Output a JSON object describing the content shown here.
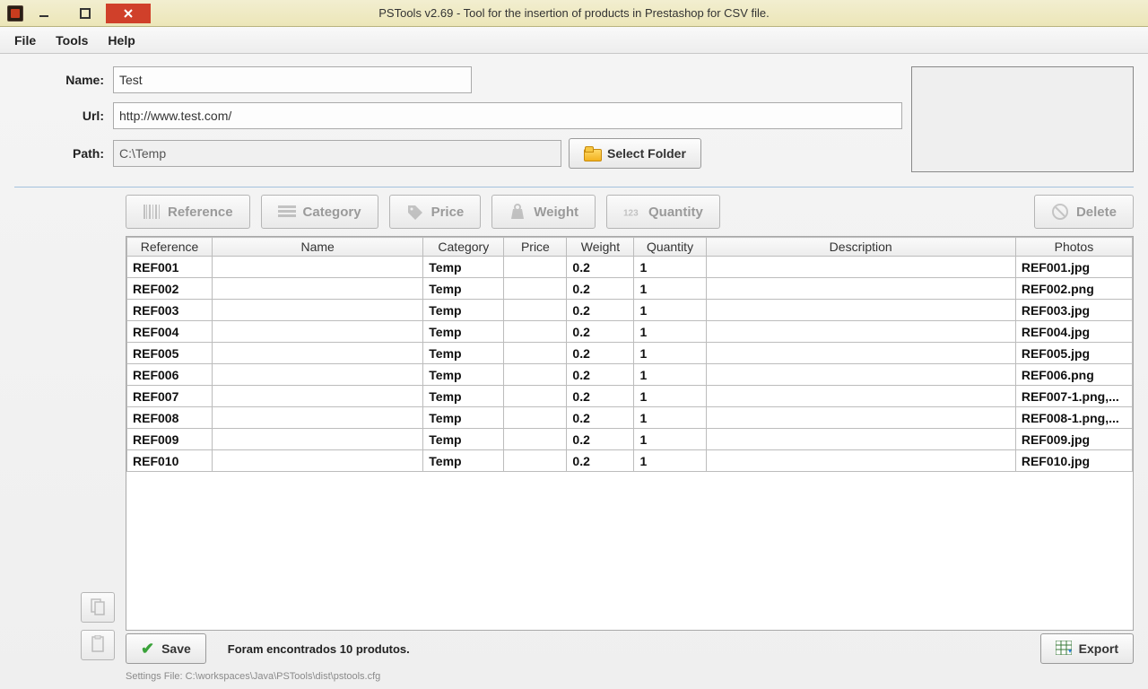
{
  "window": {
    "title": "PSTools v2.69 - Tool for the insertion of products in Prestashop for CSV file."
  },
  "menu": {
    "file": "File",
    "tools": "Tools",
    "help": "Help"
  },
  "form": {
    "name_label": "Name:",
    "name_value": "Test",
    "url_label": "Url:",
    "url_value": "http://www.test.com/",
    "path_label": "Path:",
    "path_value": "C:\\Temp",
    "select_folder": "Select Folder"
  },
  "toolbar": {
    "reference": "Reference",
    "category": "Category",
    "price": "Price",
    "weight": "Weight",
    "quantity": "Quantity",
    "delete": "Delete"
  },
  "table": {
    "headers": {
      "reference": "Reference",
      "name": "Name",
      "category": "Category",
      "price": "Price",
      "weight": "Weight",
      "quantity": "Quantity",
      "description": "Description",
      "photos": "Photos"
    },
    "rows": [
      {
        "reference": "REF001",
        "name": "",
        "category": "Temp",
        "price": "",
        "weight": "0.2",
        "quantity": "1",
        "description": "",
        "photos": "REF001.jpg"
      },
      {
        "reference": "REF002",
        "name": "",
        "category": "Temp",
        "price": "",
        "weight": "0.2",
        "quantity": "1",
        "description": "",
        "photos": "REF002.png"
      },
      {
        "reference": "REF003",
        "name": "",
        "category": "Temp",
        "price": "",
        "weight": "0.2",
        "quantity": "1",
        "description": "",
        "photos": "REF003.jpg"
      },
      {
        "reference": "REF004",
        "name": "",
        "category": "Temp",
        "price": "",
        "weight": "0.2",
        "quantity": "1",
        "description": "",
        "photos": "REF004.jpg"
      },
      {
        "reference": "REF005",
        "name": "",
        "category": "Temp",
        "price": "",
        "weight": "0.2",
        "quantity": "1",
        "description": "",
        "photos": "REF005.jpg"
      },
      {
        "reference": "REF006",
        "name": "",
        "category": "Temp",
        "price": "",
        "weight": "0.2",
        "quantity": "1",
        "description": "",
        "photos": "REF006.png"
      },
      {
        "reference": "REF007",
        "name": "",
        "category": "Temp",
        "price": "",
        "weight": "0.2",
        "quantity": "1",
        "description": "",
        "photos": "REF007-1.png,..."
      },
      {
        "reference": "REF008",
        "name": "",
        "category": "Temp",
        "price": "",
        "weight": "0.2",
        "quantity": "1",
        "description": "",
        "photos": "REF008-1.png,..."
      },
      {
        "reference": "REF009",
        "name": "",
        "category": "Temp",
        "price": "",
        "weight": "0.2",
        "quantity": "1",
        "description": "",
        "photos": "REF009.jpg"
      },
      {
        "reference": "REF010",
        "name": "",
        "category": "Temp",
        "price": "",
        "weight": "0.2",
        "quantity": "1",
        "description": "",
        "photos": "REF010.jpg"
      }
    ]
  },
  "bottom": {
    "save": "Save",
    "export": "Export",
    "status": "Foram encontrados 10 produtos.",
    "settings_line": "Settings File: C:\\workspaces\\Java\\PSTools\\dist\\pstools.cfg"
  }
}
